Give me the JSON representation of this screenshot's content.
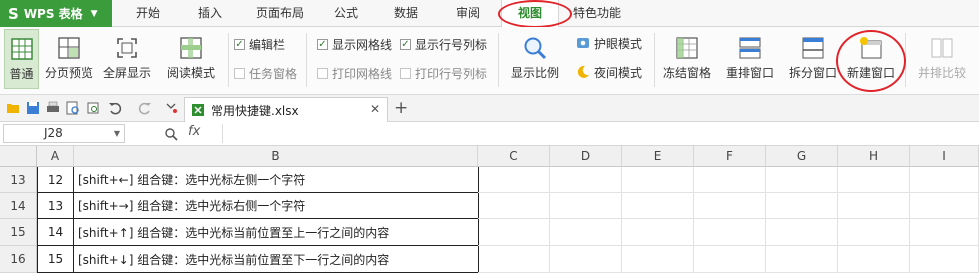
{
  "app": {
    "brand": "WPS 表格"
  },
  "menu": {
    "tabs": [
      "开始",
      "插入",
      "页面布局",
      "公式",
      "数据",
      "审阅",
      "视图",
      "特色功能"
    ],
    "active": "视图"
  },
  "ribbon": {
    "normal": "普通",
    "page_break": "分页预览",
    "full_screen": "全屏显示",
    "reading_mode": "阅读模式",
    "edit_bar": "编辑栏",
    "task_pane": "任务窗格",
    "show_gridlines": "显示网格线",
    "show_headers": "显示行号列标",
    "print_gridlines": "打印网格线",
    "print_headers": "打印行号列标",
    "zoom": "显示比例",
    "eye_mode": "护眼模式",
    "night_mode": "夜间模式",
    "freeze": "冻结窗格",
    "arrange": "重排窗口",
    "split": "拆分窗口",
    "new_window": "新建窗口",
    "side_by_side": "并排比较",
    "checks": {
      "edit_bar": true,
      "task_pane": false,
      "show_gridlines": true,
      "show_headers": true,
      "print_gridlines": false,
      "print_headers": false
    }
  },
  "doc_tab": {
    "name": "常用快捷键.xlsx"
  },
  "formula_bar": {
    "cell_ref": "J28",
    "fx": "fx",
    "value": ""
  },
  "sheet": {
    "columns": [
      "A",
      "B",
      "C",
      "D",
      "E",
      "F",
      "G",
      "H",
      "I"
    ],
    "rows": [
      {
        "row": "13",
        "a": "12",
        "b": "[shift+←] 组合键：选中光标左侧一个字符"
      },
      {
        "row": "14",
        "a": "13",
        "b": "[shift+→] 组合键：选中光标右侧一个字符"
      },
      {
        "row": "15",
        "a": "14",
        "b": "[shift+↑] 组合键：选中光标当前位置至上一行之间的内容"
      },
      {
        "row": "16",
        "a": "15",
        "b": "[shift+↓] 组合键：选中光标当前位置至下一行之间的内容"
      }
    ]
  },
  "colors": {
    "accent_green": "#3b9c3b",
    "highlight_red": "#e0242a"
  },
  "icons": [
    "normal-view-icon",
    "page-break-icon",
    "full-screen-icon",
    "reading-mode-icon",
    "zoom-icon",
    "eye-icon",
    "moon-icon",
    "freeze-icon",
    "arrange-icon",
    "split-icon",
    "new-window-icon",
    "compare-icon",
    "folder-icon",
    "save-icon",
    "print-icon",
    "preview-icon",
    "undo-icon",
    "redo-icon",
    "excel-file-icon",
    "find-icon"
  ]
}
